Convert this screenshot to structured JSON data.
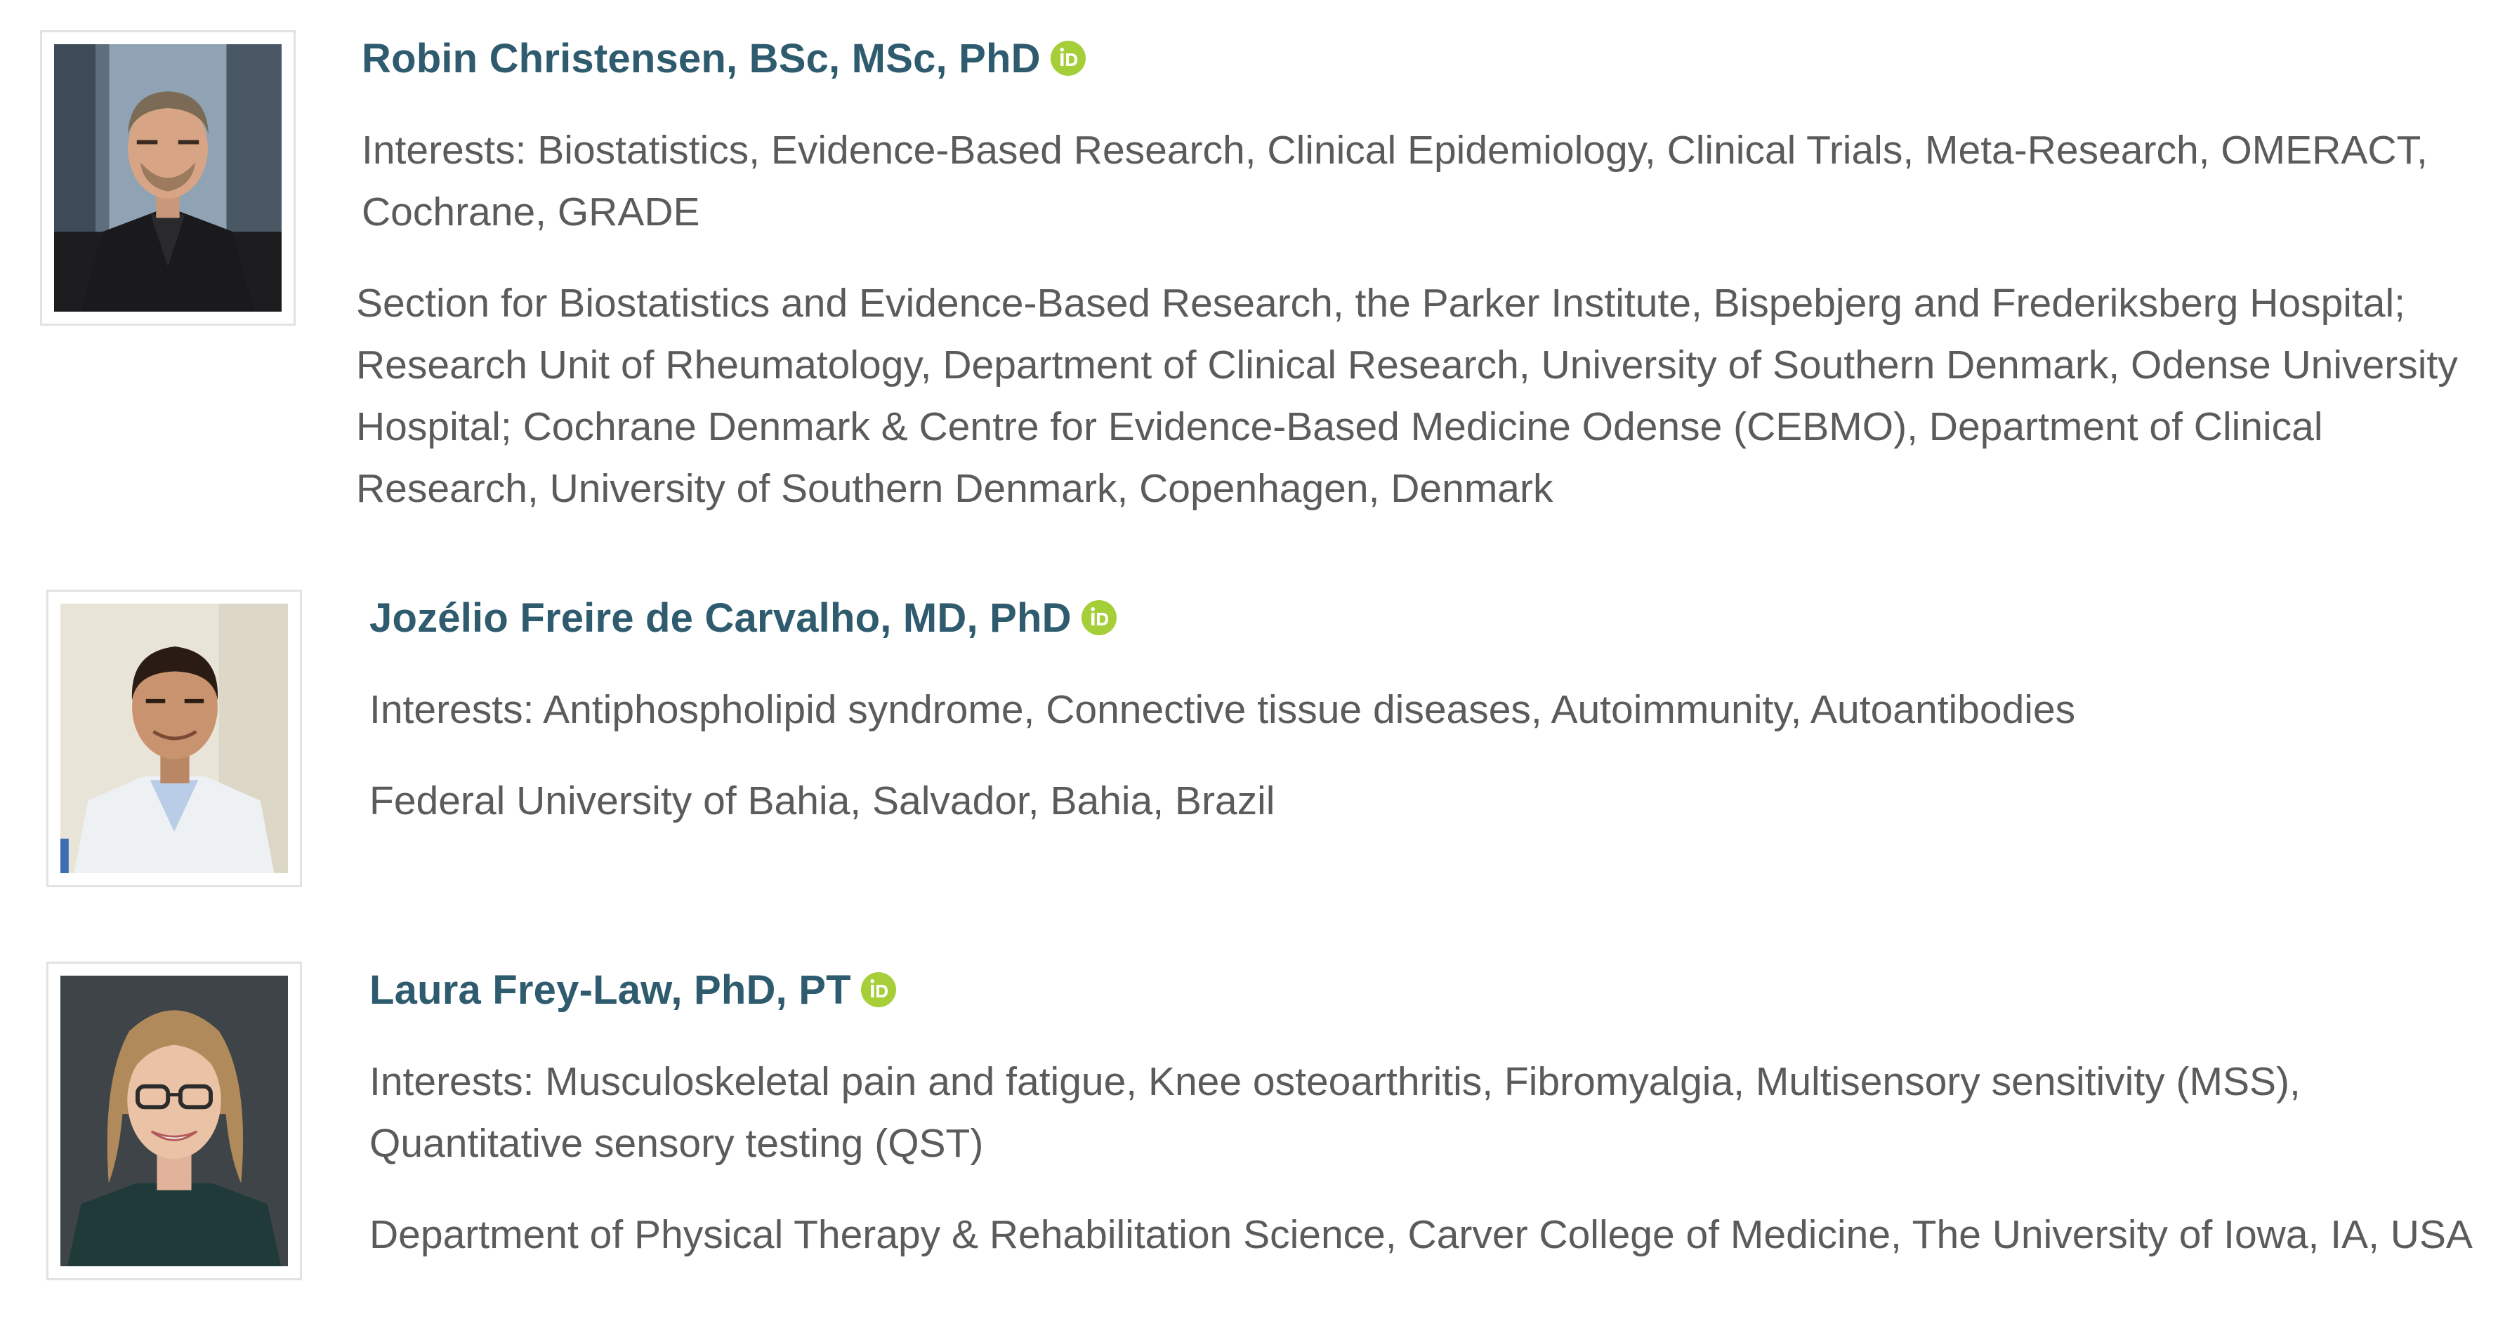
{
  "editors": [
    {
      "name": "Robin Christensen, BSc, MSc, PhD",
      "orcid_icon": "orcid-icon",
      "interests": "Interests: Biostatistics, Evidence-Based Research, Clinical Epidemiology, Clinical Trials, Meta-Research, OMERACT, Cochrane, GRADE",
      "affiliation": "Section for Biostatistics and Evidence-Based Research, the Parker Institute, Bispebjerg and Frederiksberg Hospital; Research Unit of Rheumatology, Department of Clinical Research, University of Southern Denmark, Odense University Hospital; Cochrane Denmark & Centre for Evidence-Based Medicine Odense (CEBMO), Department of Clinical Research, University of Southern Denmark, Copenhagen, Denmark"
    },
    {
      "name": "Jozélio Freire de Carvalho, MD, PhD",
      "orcid_icon": "orcid-icon",
      "interests": "Interests: Antiphospholipid syndrome, Connective tissue diseases, Autoimmunity, Autoantibodies",
      "affiliation": "Federal University of Bahia, Salvador, Bahia, Brazil"
    },
    {
      "name": "Laura Frey-Law, PhD, PT",
      "orcid_icon": "orcid-icon",
      "interests": "Interests: Musculoskeletal pain and fatigue, Knee osteoarthritis, Fibromyalgia, Multisensory sensitivity (MSS), Quantitative sensory testing (QST)",
      "affiliation": "Department of Physical Therapy & Rehabilitation Science, Carver College of Medicine, The University of Iowa, IA, USA"
    }
  ],
  "colors": {
    "name_link": "#2e5b6e",
    "body_text": "#5b5b5b",
    "orcid_green": "#a6ce39",
    "photo_border": "#e2e2e2"
  }
}
